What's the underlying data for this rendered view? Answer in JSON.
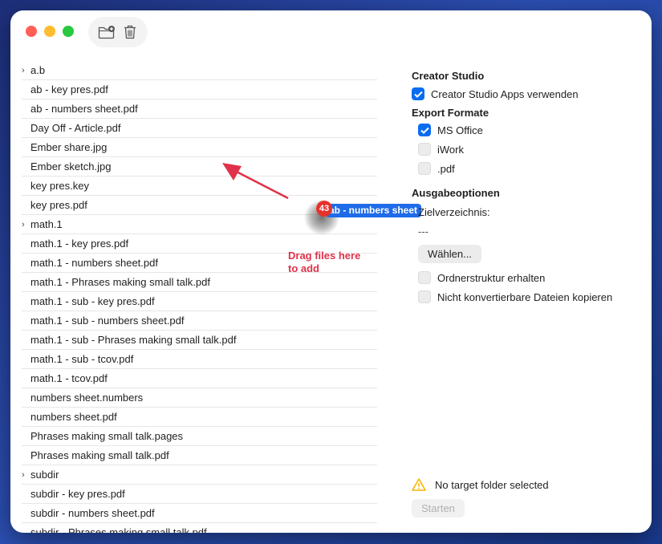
{
  "window": {
    "toolbar": {
      "new_folder_icon": "folder-plus-icon",
      "trash_icon": "trash-icon"
    }
  },
  "files": [
    {
      "name": "a.b",
      "folder": true
    },
    {
      "name": "ab - key pres.pdf",
      "folder": false
    },
    {
      "name": "ab - numbers sheet.pdf",
      "folder": false
    },
    {
      "name": "Day Off - Article.pdf",
      "folder": false
    },
    {
      "name": "Ember share.jpg",
      "folder": false
    },
    {
      "name": "Ember sketch.jpg",
      "folder": false
    },
    {
      "name": "key pres.key",
      "folder": false
    },
    {
      "name": "key pres.pdf",
      "folder": false
    },
    {
      "name": "math.1",
      "folder": true
    },
    {
      "name": "math.1 - key pres.pdf",
      "folder": false
    },
    {
      "name": "math.1 - numbers sheet.pdf",
      "folder": false
    },
    {
      "name": "math.1 - Phrases making small talk.pdf",
      "folder": false
    },
    {
      "name": "math.1 - sub - key pres.pdf",
      "folder": false
    },
    {
      "name": "math.1 - sub - numbers sheet.pdf",
      "folder": false
    },
    {
      "name": "math.1 - sub - Phrases making small talk.pdf",
      "folder": false
    },
    {
      "name": "math.1 - sub - tcov.pdf",
      "folder": false
    },
    {
      "name": "math.1 - tcov.pdf",
      "folder": false
    },
    {
      "name": "numbers sheet.numbers",
      "folder": false
    },
    {
      "name": "numbers sheet.pdf",
      "folder": false
    },
    {
      "name": "Phrases making small talk.pages",
      "folder": false
    },
    {
      "name": "Phrases making small talk.pdf",
      "folder": false
    },
    {
      "name": "subdir",
      "folder": true
    },
    {
      "name": "subdir - key pres.pdf",
      "folder": false
    },
    {
      "name": "subdir - numbers sheet.pdf",
      "folder": false
    },
    {
      "name": "subdir - Phrases making small talk.pdf",
      "folder": false
    }
  ],
  "drag": {
    "badge_count": "43",
    "label": "ab - numbers sheet",
    "hint": "Drag files here to add",
    "hint_line1": "Drag files here",
    "hint_line2": "to add",
    "accent": "#e0324a"
  },
  "settings": {
    "creator_studio": {
      "title": "Creator Studio",
      "use_apps_label": "Creator Studio Apps verwenden",
      "use_apps_checked": true
    },
    "export": {
      "title": "Export Formate",
      "options": [
        {
          "label": "MS Office",
          "checked": true
        },
        {
          "label": "iWork",
          "checked": false
        },
        {
          "label": ".pdf",
          "checked": false
        }
      ]
    },
    "output": {
      "title": "Ausgabeoptionen",
      "target_label": "Zielverzeichnis:",
      "target_value": "---",
      "choose_button": "Wählen...",
      "keep_structure_label": "Ordnerstruktur erhalten",
      "keep_structure_checked": false,
      "copy_unconvertible_label": "Nicht konvertierbare Dateien kopieren",
      "copy_unconvertible_checked": false
    },
    "status": {
      "warning_icon": "warning-icon",
      "message": "No target folder selected",
      "start_button": "Starten"
    }
  },
  "colors": {
    "accent_blue": "#0a6cf0",
    "warning_yellow": "#f5b400"
  }
}
